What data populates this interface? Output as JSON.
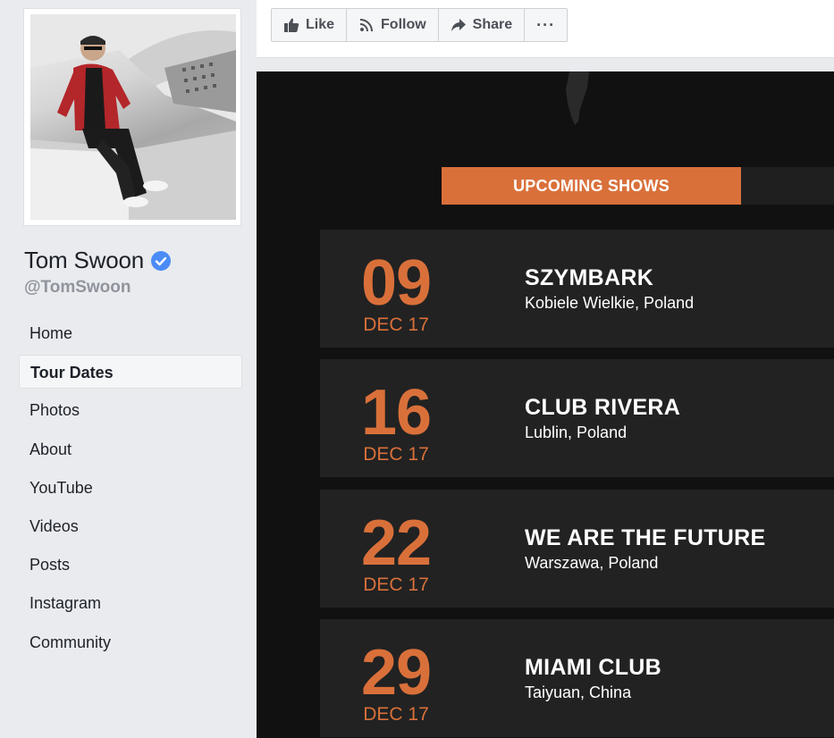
{
  "profile": {
    "name": "Tom Swoon",
    "handle": "@TomSwoon"
  },
  "nav": {
    "items": [
      {
        "label": "Home"
      },
      {
        "label": "Tour Dates",
        "active": true
      },
      {
        "label": "Photos"
      },
      {
        "label": "About"
      },
      {
        "label": "YouTube"
      },
      {
        "label": "Videos"
      },
      {
        "label": "Posts"
      },
      {
        "label": "Instagram"
      },
      {
        "label": "Community"
      }
    ]
  },
  "actions": {
    "like": "Like",
    "follow": "Follow",
    "share": "Share",
    "more": "···"
  },
  "tour": {
    "tab_active": "UPCOMING SHOWS",
    "shows": [
      {
        "day": "09",
        "month": "DEC 17",
        "title": "SZYMBARK",
        "location": "Kobiele Wielkie, Poland"
      },
      {
        "day": "16",
        "month": "DEC 17",
        "title": "CLUB RIVERA",
        "location": "Lublin, Poland"
      },
      {
        "day": "22",
        "month": "DEC 17",
        "title": "WE ARE THE FUTURE",
        "location": "Warszawa, Poland"
      },
      {
        "day": "29",
        "month": "DEC 17",
        "title": "MIAMI CLUB",
        "location": "Taiyuan, China"
      }
    ]
  },
  "colors": {
    "accent": "#d9703a",
    "verified": "#4a8bf5",
    "widget_bg": "#111111",
    "card_bg": "#222222"
  }
}
